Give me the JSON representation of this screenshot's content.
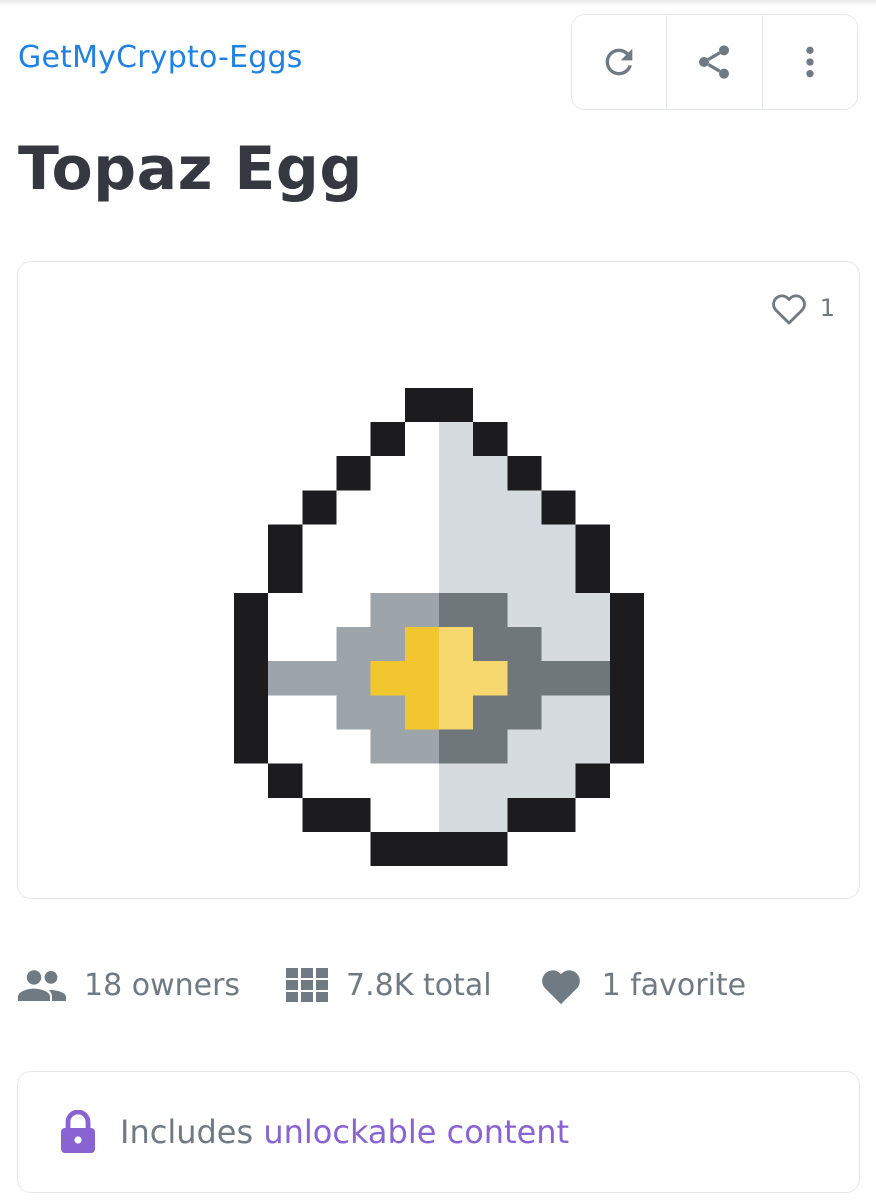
{
  "collection": {
    "name": "GetMyCrypto-Eggs"
  },
  "toolbar": {
    "refresh_icon": "refresh-icon",
    "share_icon": "share-icon",
    "more_icon": "more-vertical-icon"
  },
  "item": {
    "title": "Topaz Egg",
    "favorite_count": "1"
  },
  "stats": {
    "owners": "18 owners",
    "total": "7.8K total",
    "favorites": "1 favorite"
  },
  "unlockable": {
    "prefix": "Includes ",
    "link": "unlockable content"
  },
  "colors": {
    "link_blue": "#2081e2",
    "heading": "#353840",
    "muted": "#707a83",
    "purple": "#8a63d2",
    "egg_yellow": "#f2c62e",
    "egg_yellow_light": "#f7d86e",
    "egg_band_light": "#9da5ab",
    "egg_band_dark": "#6f777b",
    "egg_shell_shade": "#d6dbdf"
  }
}
